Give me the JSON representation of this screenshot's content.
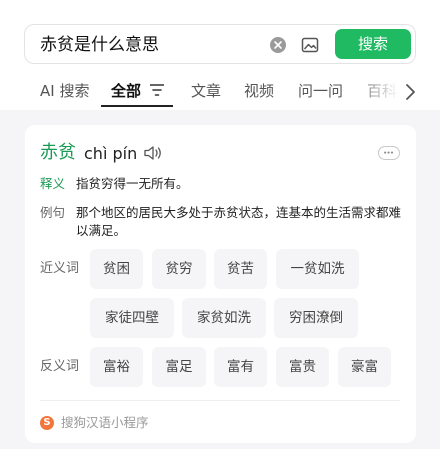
{
  "search": {
    "query": "赤贫是什么意思",
    "button_label": "搜索"
  },
  "tabs": {
    "items": [
      "AI 搜索",
      "全部",
      "文章",
      "视频",
      "问一问",
      "百科"
    ],
    "active": "全部"
  },
  "entry": {
    "word": "赤贫",
    "pinyin": "chì pín",
    "definition_label": "释义",
    "definition": "指贫穷得一无所有。",
    "example_label": "例句",
    "example": "那个地区的居民大多处于赤贫状态，连基本的生活需求都难以满足。",
    "synonyms_label": "近义词",
    "synonyms": [
      "贫困",
      "贫穷",
      "贫苦",
      "一贫如洗",
      "家徒四壁",
      "家贫如洗",
      "穷困潦倒"
    ],
    "antonyms_label": "反义词",
    "antonyms": [
      "富裕",
      "富足",
      "富有",
      "富贵",
      "豪富"
    ]
  },
  "source": {
    "logo_letter": "S",
    "label": "搜狗汉语小程序"
  },
  "colors": {
    "accent_green": "#1fba62",
    "headword_green": "#1a9b55",
    "chip_bg": "#f5f5f7"
  }
}
